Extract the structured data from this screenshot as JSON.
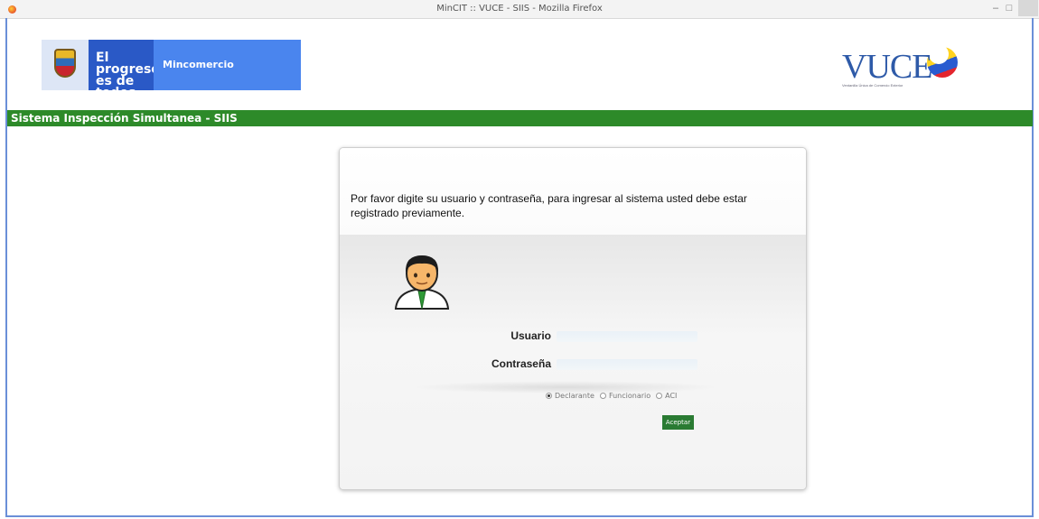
{
  "window": {
    "title": "MinCIT :: VUCE - SIIS - Mozilla Firefox",
    "min_glyph": "–",
    "max_glyph": "□"
  },
  "header": {
    "gov_slogan": "El progreso es de todos",
    "ministry": "Mincomercio",
    "vuce_logo_text": "VUCE",
    "vuce_logo_subtitle": "Ventanilla Única de Comercio Exterior"
  },
  "system": {
    "title": "Sistema Inspección Simultanea - SIIS"
  },
  "login": {
    "instructions": "Por favor digite su usuario y contraseña, para ingresar al sistema usted debe estar registrado previamente.",
    "user_label": "Usuario",
    "user_value": "",
    "password_label": "Contraseña",
    "password_value": "",
    "roles": [
      {
        "label": "Declarante",
        "selected": true
      },
      {
        "label": "Funcionario",
        "selected": false
      },
      {
        "label": "ACI",
        "selected": false
      }
    ],
    "submit_label": "Aceptar"
  },
  "colors": {
    "green_bar": "#2d8a29",
    "gov_blue_dark": "#2a59c6",
    "gov_blue_light": "#4a85ee",
    "vuce_blue": "#2e5aa8",
    "accept_button": "#2a7b33"
  },
  "icons": {
    "browser": "firefox-icon",
    "avatar": "user-avatar-icon",
    "crest": "colombia-crest-icon"
  }
}
